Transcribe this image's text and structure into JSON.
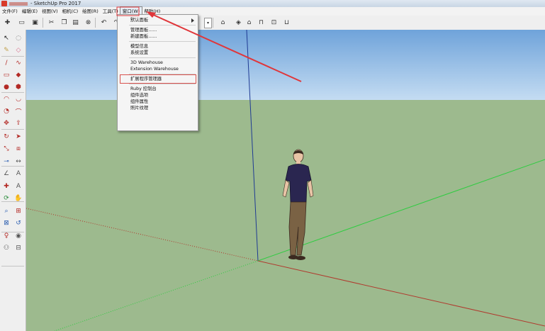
{
  "window": {
    "title": "- SketchUp Pro 2017",
    "icon": "sketchup-icon"
  },
  "menubar": {
    "items": [
      {
        "label": "文件(F)"
      },
      {
        "label": "编辑(E)"
      },
      {
        "label": "视图(V)"
      },
      {
        "label": "相机(C)"
      },
      {
        "label": "绘图(R)"
      },
      {
        "label": "工具(T)"
      },
      {
        "label": "窗口(W)"
      },
      {
        "label": "帮助(H)"
      }
    ],
    "active": "窗口(W)"
  },
  "window_menu": {
    "groups": [
      [
        {
          "label": "默认面板",
          "submenu": true
        }
      ],
      [
        {
          "label": "管理面板......"
        },
        {
          "label": "新建面板......"
        }
      ],
      [
        {
          "label": "模型信息"
        },
        {
          "label": "系统设置"
        }
      ],
      [
        {
          "label": "3D Warehouse"
        },
        {
          "label": "Extension Warehouse"
        }
      ],
      [
        {
          "label": "扩展程序管理器",
          "highlighted": true
        }
      ],
      [
        {
          "label": "Ruby 控制台"
        },
        {
          "label": "组件选项"
        },
        {
          "label": "组件属性"
        },
        {
          "label": "照片纹理"
        }
      ]
    ]
  },
  "annotation": {
    "color": "#e0363a"
  },
  "colors": {
    "sky_top": "#6fa3da",
    "ground": "#9dba8e",
    "axis_red": "#c0392b",
    "axis_green": "#2ecc40",
    "axis_blue": "#1f3a93"
  },
  "icons": {
    "toolbar": [
      "new-icon",
      "open-icon",
      "save-icon",
      "cut-icon",
      "copy-icon",
      "paste-icon",
      "erase-icon",
      "undo-icon",
      "redo-icon",
      "warehouse-icon",
      "extension-icon",
      "home-icon",
      "front-view-icon",
      "top-view-icon",
      "back-view-icon"
    ],
    "left_tools": [
      "select-icon",
      "component-icon",
      "paint-icon",
      "eraser-icon",
      "line-icon",
      "freehand-icon",
      "rectangle-icon",
      "rotated-rect-icon",
      "circle-icon",
      "polygon-icon",
      "arc-icon",
      "two-point-arc-icon",
      "pie-icon",
      "three-point-arc-icon",
      "move-icon",
      "push-pull-icon",
      "rotate-icon",
      "follow-me-icon",
      "scale-icon",
      "offset-icon",
      "tape-icon",
      "dimension-icon",
      "protractor-icon",
      "text-icon",
      "axes-icon",
      "3d-text-icon",
      "orbit-icon",
      "pan-icon",
      "zoom-icon",
      "zoom-window-icon",
      "zoom-extents-icon",
      "previous-view-icon",
      "position-camera-icon",
      "look-around-icon",
      "walk-icon",
      "section-icon"
    ]
  }
}
